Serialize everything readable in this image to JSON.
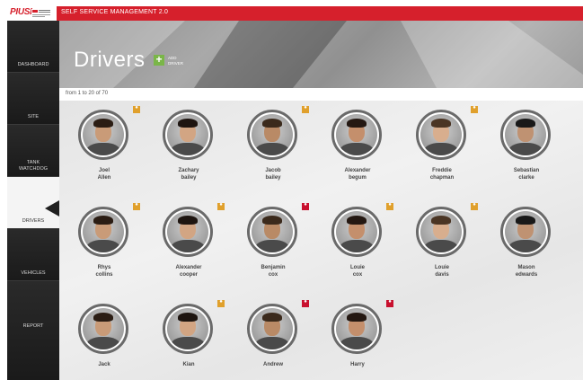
{
  "app": {
    "logo_text": "PIUSI",
    "title": "SELF SERVICE MANAGEMENT 2.0"
  },
  "colors": {
    "brand": "#d6202c",
    "add": "#7ab648",
    "badge_orange": "#e0a02c",
    "badge_red": "#c8102e"
  },
  "sidebar": {
    "items": [
      {
        "label": "DASHBOARD",
        "active": false
      },
      {
        "label": "SITE",
        "active": false
      },
      {
        "label": "TANK WATCHDOG",
        "active": false
      },
      {
        "label": "DRIVERS",
        "active": true
      },
      {
        "label": "VEHICLES",
        "active": false
      },
      {
        "label": "REPORT",
        "active": false
      }
    ]
  },
  "header": {
    "title": "Drivers",
    "add_icon": "plus-icon",
    "add_label_line1": "ADD",
    "add_label_line2": "DRIVER"
  },
  "results": {
    "text": "from 1 to 20 of 70"
  },
  "drivers": [
    {
      "first": "Joel",
      "last": "Allen",
      "badge": "orange"
    },
    {
      "first": "Zachary",
      "last": "bailey",
      "badge": "none"
    },
    {
      "first": "Jacob",
      "last": "bailey",
      "badge": "orange"
    },
    {
      "first": "Alexander",
      "last": "begum",
      "badge": "none"
    },
    {
      "first": "Freddie",
      "last": "chapman",
      "badge": "orange"
    },
    {
      "first": "Sebastian",
      "last": "clarke",
      "badge": "none"
    },
    {
      "first": "Rhys",
      "last": "collins",
      "badge": "orange"
    },
    {
      "first": "Alexander",
      "last": "cooper",
      "badge": "orange"
    },
    {
      "first": "Benjamin",
      "last": "cox",
      "badge": "red"
    },
    {
      "first": "Louie",
      "last": "cox",
      "badge": "orange"
    },
    {
      "first": "Louie",
      "last": "davis",
      "badge": "orange"
    },
    {
      "first": "Mason",
      "last": "edwards",
      "badge": "none"
    },
    {
      "first": "Jack",
      "last": "",
      "badge": "none"
    },
    {
      "first": "Kian",
      "last": "",
      "badge": "orange"
    },
    {
      "first": "Andrew",
      "last": "",
      "badge": "red"
    },
    {
      "first": "Harry",
      "last": "",
      "badge": "red"
    }
  ]
}
